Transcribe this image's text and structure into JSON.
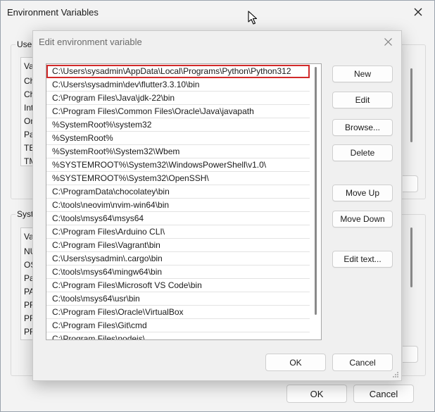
{
  "background_window": {
    "title": "Environment Variables",
    "user_group_label": "User",
    "user_list_items": [
      "Va",
      "Ch",
      "Ch",
      "Int",
      "On",
      "Pa",
      "TE",
      "TM"
    ],
    "system_group_label": "Syste",
    "system_list_items": [
      "Va",
      "NU",
      "OS",
      "Pa",
      "PA",
      "PR",
      "PR",
      "PR"
    ],
    "ok_label": "OK",
    "cancel_label": "Cancel"
  },
  "dialog": {
    "title": "Edit environment variable",
    "paths": [
      "C:\\Users\\sysadmin\\AppData\\Local\\Programs\\Python\\Python312",
      "C:\\Users\\sysadmin\\dev\\flutter3.3.10\\bin",
      "C:\\Program Files\\Java\\jdk-22\\bin",
      "C:\\Program Files\\Common Files\\Oracle\\Java\\javapath",
      "%SystemRoot%\\system32",
      "%SystemRoot%",
      "%SystemRoot%\\System32\\Wbem",
      "%SYSTEMROOT%\\System32\\WindowsPowerShell\\v1.0\\",
      "%SYSTEMROOT%\\System32\\OpenSSH\\",
      "C:\\ProgramData\\chocolatey\\bin",
      "C:\\tools\\neovim\\nvim-win64\\bin",
      "C:\\tools\\msys64\\msys64",
      "C:\\Program Files\\Arduino CLI\\",
      "C:\\Program Files\\Vagrant\\bin",
      "C:\\Users\\sysadmin\\.cargo\\bin",
      "C:\\tools\\msys64\\mingw64\\bin",
      "C:\\Program Files\\Microsoft VS Code\\bin",
      "C:\\tools\\msys64\\usr\\bin",
      "C:\\Program Files\\Oracle\\VirtualBox",
      "C:\\Program Files\\Git\\cmd",
      "C:\\Program Files\\nodejs\\"
    ],
    "buttons": {
      "new": "New",
      "edit": "Edit",
      "browse": "Browse...",
      "delete": "Delete",
      "move_up": "Move Up",
      "move_down": "Move Down",
      "edit_text": "Edit text..."
    },
    "ok_label": "OK",
    "cancel_label": "Cancel"
  },
  "colors": {
    "selection_outline": "#d12a2a"
  }
}
